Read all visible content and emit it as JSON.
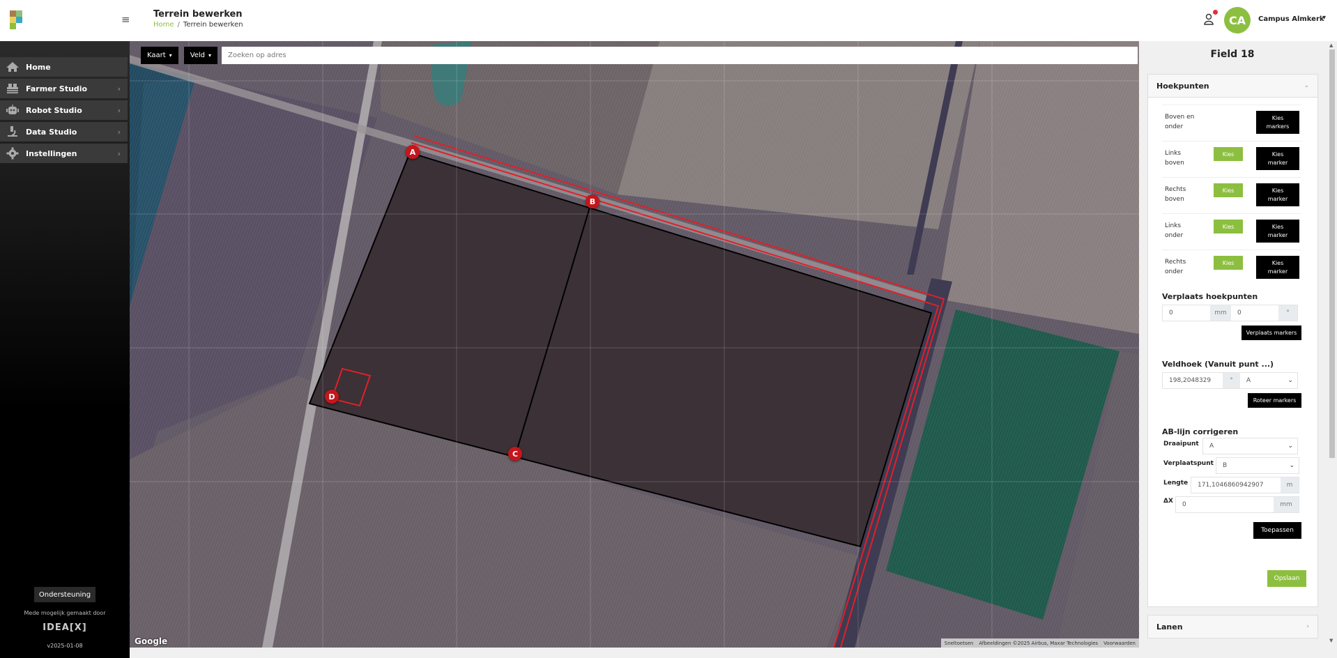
{
  "header": {
    "logo_colors": [
      "#a97c4b",
      "#8ec07d",
      "#e7d35a",
      "#35a9c4",
      "#8cbf3f"
    ],
    "menu_icon": "hamburger-icon",
    "title": "Terrein bewerken",
    "breadcrumb": [
      {
        "label": "Home",
        "link": true
      },
      {
        "label": "Terrein bewerken",
        "link": false
      }
    ],
    "notification_icon": "user-notification-icon",
    "avatar_initials": "CA",
    "username": "Campus Almkerk",
    "user_caret": "▾"
  },
  "sidebar": {
    "items": [
      {
        "label": "Home",
        "icon": "home-icon",
        "has_children": false
      },
      {
        "label": "Farmer Studio",
        "icon": "farm-icon",
        "has_children": true
      },
      {
        "label": "Robot Studio",
        "icon": "robot-icon",
        "has_children": true
      },
      {
        "label": "Data Studio",
        "icon": "microscope-icon",
        "has_children": true
      },
      {
        "label": "Instellingen",
        "icon": "gear-icon",
        "has_children": true
      }
    ],
    "chevron": "›",
    "support_label": "Ondersteuning",
    "made_by": "Mede mogelijk gemaakt door",
    "brand": "IDEA[X]",
    "version": "v2025-01-08"
  },
  "map": {
    "map_dropdown": "Kaart",
    "field_dropdown": "Veld",
    "search_placeholder": "Zoeken op adres",
    "search_value": "",
    "google_label": "Google",
    "attribution": {
      "shortcuts": "Sneltoetsen",
      "imagery": "Afbeeldingen ©2025 Airbus, Maxar Technologies",
      "terms": "Voorwaarden"
    },
    "markers": [
      {
        "label": "A"
      },
      {
        "label": "B"
      },
      {
        "label": "C"
      },
      {
        "label": "D"
      }
    ],
    "colors": {
      "marker": "#c4161c",
      "boundary": "#e0202a",
      "field_outline": "#000000"
    }
  },
  "panel": {
    "title": "Field 18",
    "corner_section": {
      "title": "Hoekpunten",
      "rows": [
        {
          "label_line1": "Boven en",
          "label_line2": "onder",
          "kies": null,
          "marker_line1": "Kies",
          "marker_line2": "markers"
        },
        {
          "label_line1": "Links",
          "label_line2": "boven",
          "kies": "Kies",
          "marker_line1": "Kies",
          "marker_line2": "marker"
        },
        {
          "label_line1": "Rechts",
          "label_line2": "boven",
          "kies": "Kies",
          "marker_line1": "Kies",
          "marker_line2": "marker"
        },
        {
          "label_line1": "Links",
          "label_line2": "onder",
          "kies": "Kies",
          "marker_line1": "Kies",
          "marker_line2": "marker"
        },
        {
          "label_line1": "Rechts",
          "label_line2": "onder",
          "kies": "Kies",
          "marker_line1": "Kies",
          "marker_line2": "marker"
        }
      ]
    },
    "move_corners": {
      "title": "Verplaats hoekpunten",
      "distance_value": "0",
      "distance_unit": "mm",
      "angle_value": "0",
      "angle_unit": "°",
      "button": "Verplaats markers"
    },
    "field_angle": {
      "title": "Veldhoek (Vanuit punt ...)",
      "angle_value": "198,2048329",
      "angle_unit": "°",
      "point": "A",
      "button": "Roteer markers"
    },
    "ab_line": {
      "title": "AB-lijn corrigeren",
      "pivot_label": "Draaipunt",
      "pivot_value": "A",
      "move_label": "Verplaatspunt",
      "move_value": "B",
      "length_label": "Lengte",
      "length_value": "171,1046860942907",
      "length_unit": "m",
      "dx_label": "ΔX",
      "dx_value": "0",
      "dx_unit": "mm",
      "apply_button": "Toepassen"
    },
    "save_button": "Opslaan",
    "lanes_section": {
      "title": "Lanen"
    },
    "colors": {
      "accent": "#8cbf3f",
      "button_dark": "#000000"
    }
  }
}
